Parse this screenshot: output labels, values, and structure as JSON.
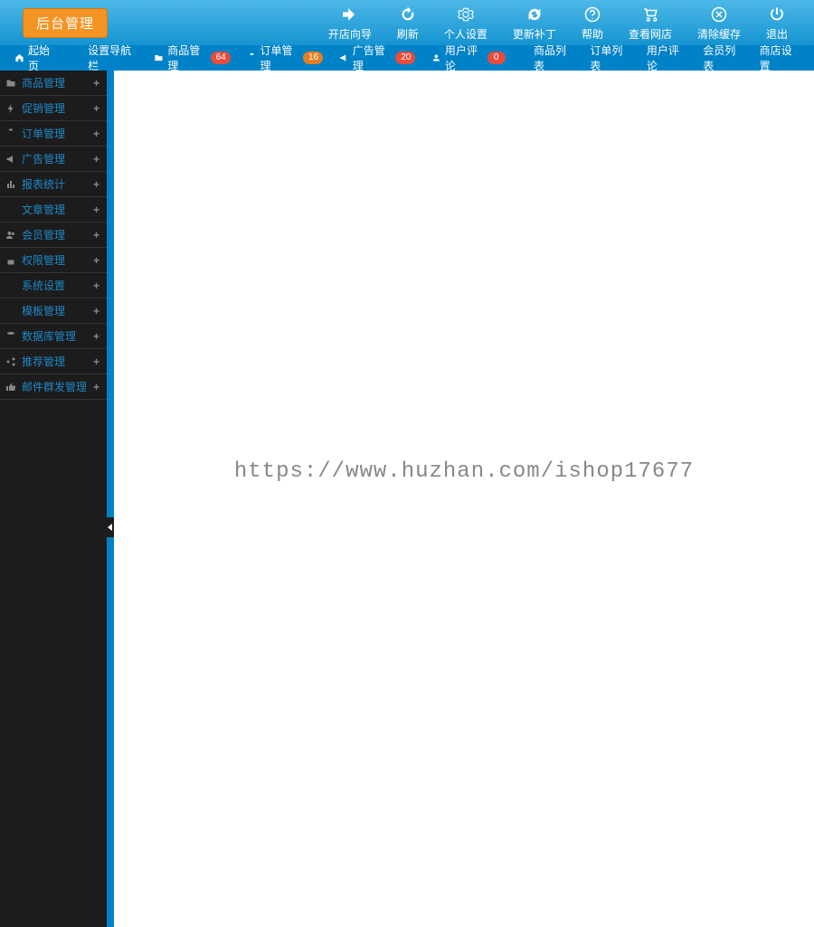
{
  "header": {
    "logo": "后台管理",
    "tools": [
      {
        "label": "开店向导",
        "icon": "arrow-forward-icon"
      },
      {
        "label": "刷新",
        "icon": "refresh-icon"
      },
      {
        "label": "个人设置",
        "icon": "gear-icon"
      },
      {
        "label": "更新补丁",
        "icon": "sync-icon"
      },
      {
        "label": "帮助",
        "icon": "help-icon"
      },
      {
        "label": "查看网店",
        "icon": "cart-icon"
      },
      {
        "label": "清除缓存",
        "icon": "clear-icon"
      },
      {
        "label": "退出",
        "icon": "power-icon"
      }
    ]
  },
  "nav": {
    "tabs": [
      {
        "label": "起始页",
        "icon": "home-icon"
      },
      {
        "label": "设置导航栏",
        "icon": "config-icon"
      },
      {
        "label": "商品管理",
        "icon": "folder-icon",
        "badge": "64",
        "badgeClass": "badge-red"
      },
      {
        "label": "订单管理",
        "icon": "clipboard-icon",
        "badge": "16",
        "badgeClass": "badge-orange"
      },
      {
        "label": "广告管理",
        "icon": "megaphone-icon",
        "badge": "20",
        "badgeClass": "badge-red"
      },
      {
        "label": "用户评论",
        "icon": "user-icon",
        "badge": "0",
        "badgeClass": "badge-red"
      }
    ],
    "links": [
      {
        "label": "商品列表"
      },
      {
        "label": "订单列表"
      },
      {
        "label": "用户评论"
      },
      {
        "label": "会员列表"
      },
      {
        "label": "商店设置"
      }
    ]
  },
  "sidebar": {
    "items": [
      {
        "label": "商品管理",
        "icon": "folder-icon"
      },
      {
        "label": "促销管理",
        "icon": "bolt-icon"
      },
      {
        "label": "订单管理",
        "icon": "clipboard-icon"
      },
      {
        "label": "广告管理",
        "icon": "megaphone-icon"
      },
      {
        "label": "报表统计",
        "icon": "chart-icon"
      },
      {
        "label": "文章管理",
        "icon": "lines-icon"
      },
      {
        "label": "会员管理",
        "icon": "users-icon"
      },
      {
        "label": "权限管理",
        "icon": "lock-icon"
      },
      {
        "label": "系统设置",
        "icon": "mail-icon"
      },
      {
        "label": "模板管理",
        "icon": "template-icon"
      },
      {
        "label": "数据库管理",
        "icon": "database-icon"
      },
      {
        "label": "推荐管理",
        "icon": "share-icon"
      },
      {
        "label": "邮件群发管理",
        "icon": "thumb-icon"
      }
    ]
  },
  "content": {
    "watermark": "https://www.huzhan.com/ishop17677"
  }
}
